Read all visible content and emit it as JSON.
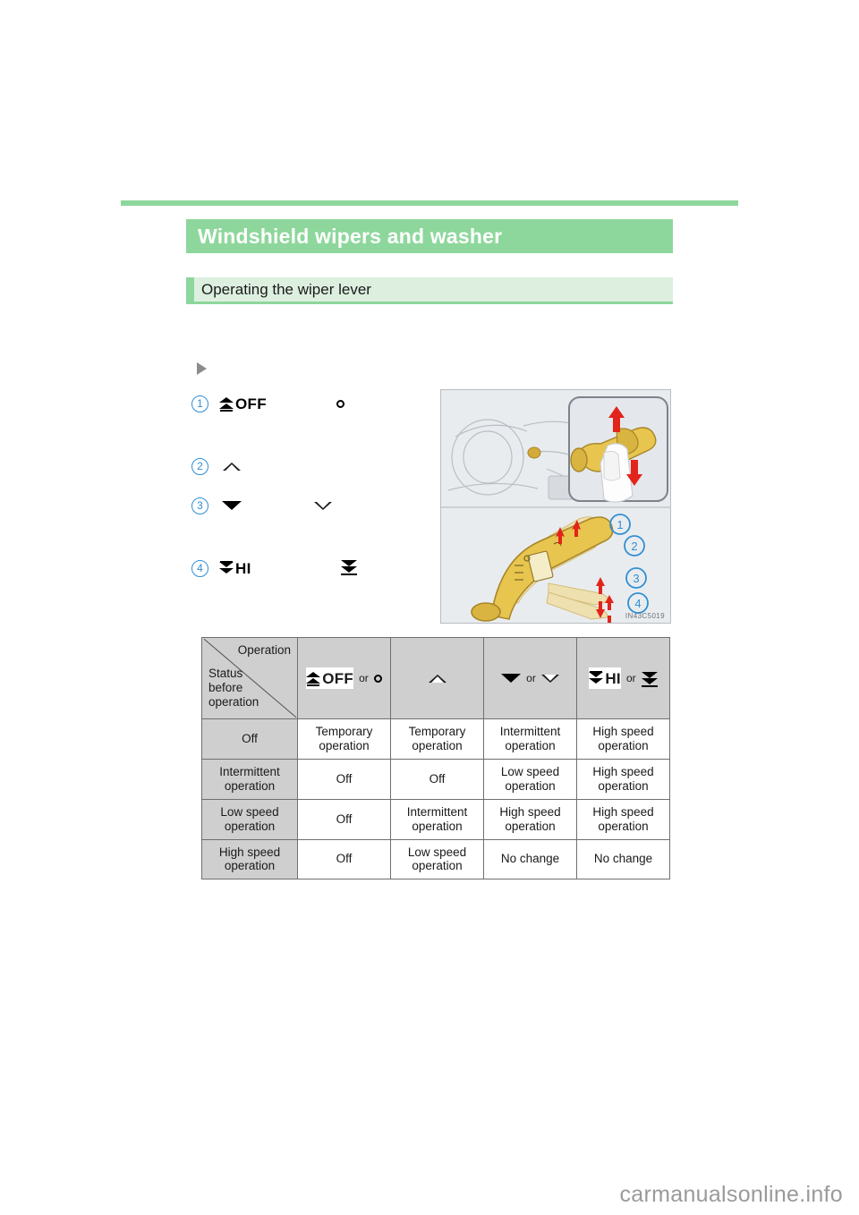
{
  "page": {
    "chapter_title": "Windshield wipers and washer",
    "section_title": "Operating the wiper lever",
    "figure_code": "IN43C5019",
    "watermark": "carmanualsonline.info",
    "accent_green": "#8ed79c",
    "light_green": "#ddf0e0",
    "callout_blue": "#2f8fd4",
    "table_header_gray": "#cfcfcf"
  },
  "lever_positions": [
    {
      "number": "1",
      "primary_symbol": "OFF",
      "alt_symbol": "dot",
      "icon": "wiper-off-icon"
    },
    {
      "number": "2",
      "primary_symbol": "",
      "alt_symbol": "",
      "icon": "triangle-up-open-icon"
    },
    {
      "number": "3",
      "primary_symbol": "",
      "alt_symbol": "",
      "icon": "triangle-down-solid-icon"
    },
    {
      "number": "4",
      "primary_symbol": "HI",
      "alt_symbol": "",
      "icon": "wiper-hi-icon"
    }
  ],
  "table": {
    "corner": {
      "column_label": "Operation",
      "row_label_line1": "Status",
      "row_label_line2": "before",
      "row_label_line3": "operation"
    },
    "columns": [
      {
        "label": "OFF",
        "or": "or",
        "alt": "dot"
      },
      {
        "label": "",
        "or": "",
        "alt": ""
      },
      {
        "label": "",
        "or": "or",
        "alt": ""
      },
      {
        "label": "HI",
        "or": "or",
        "alt": ""
      }
    ],
    "rows": [
      {
        "status": "Off",
        "cells": [
          "Temporary operation",
          "Temporary operation",
          "Intermittent operation",
          "High speed operation"
        ]
      },
      {
        "status": "Intermittent operation",
        "cells": [
          "Off",
          "Off",
          "Low speed operation",
          "High speed operation"
        ]
      },
      {
        "status": "Low speed operation",
        "cells": [
          "Off",
          "Intermittent operation",
          "High speed operation",
          "High speed operation"
        ]
      },
      {
        "status": "High speed operation",
        "cells": [
          "Off",
          "Low speed operation",
          "No change",
          "No change"
        ]
      }
    ]
  },
  "illustration": {
    "callouts": [
      "1",
      "2",
      "3",
      "4"
    ],
    "description": "wiper-lever-diagram"
  }
}
